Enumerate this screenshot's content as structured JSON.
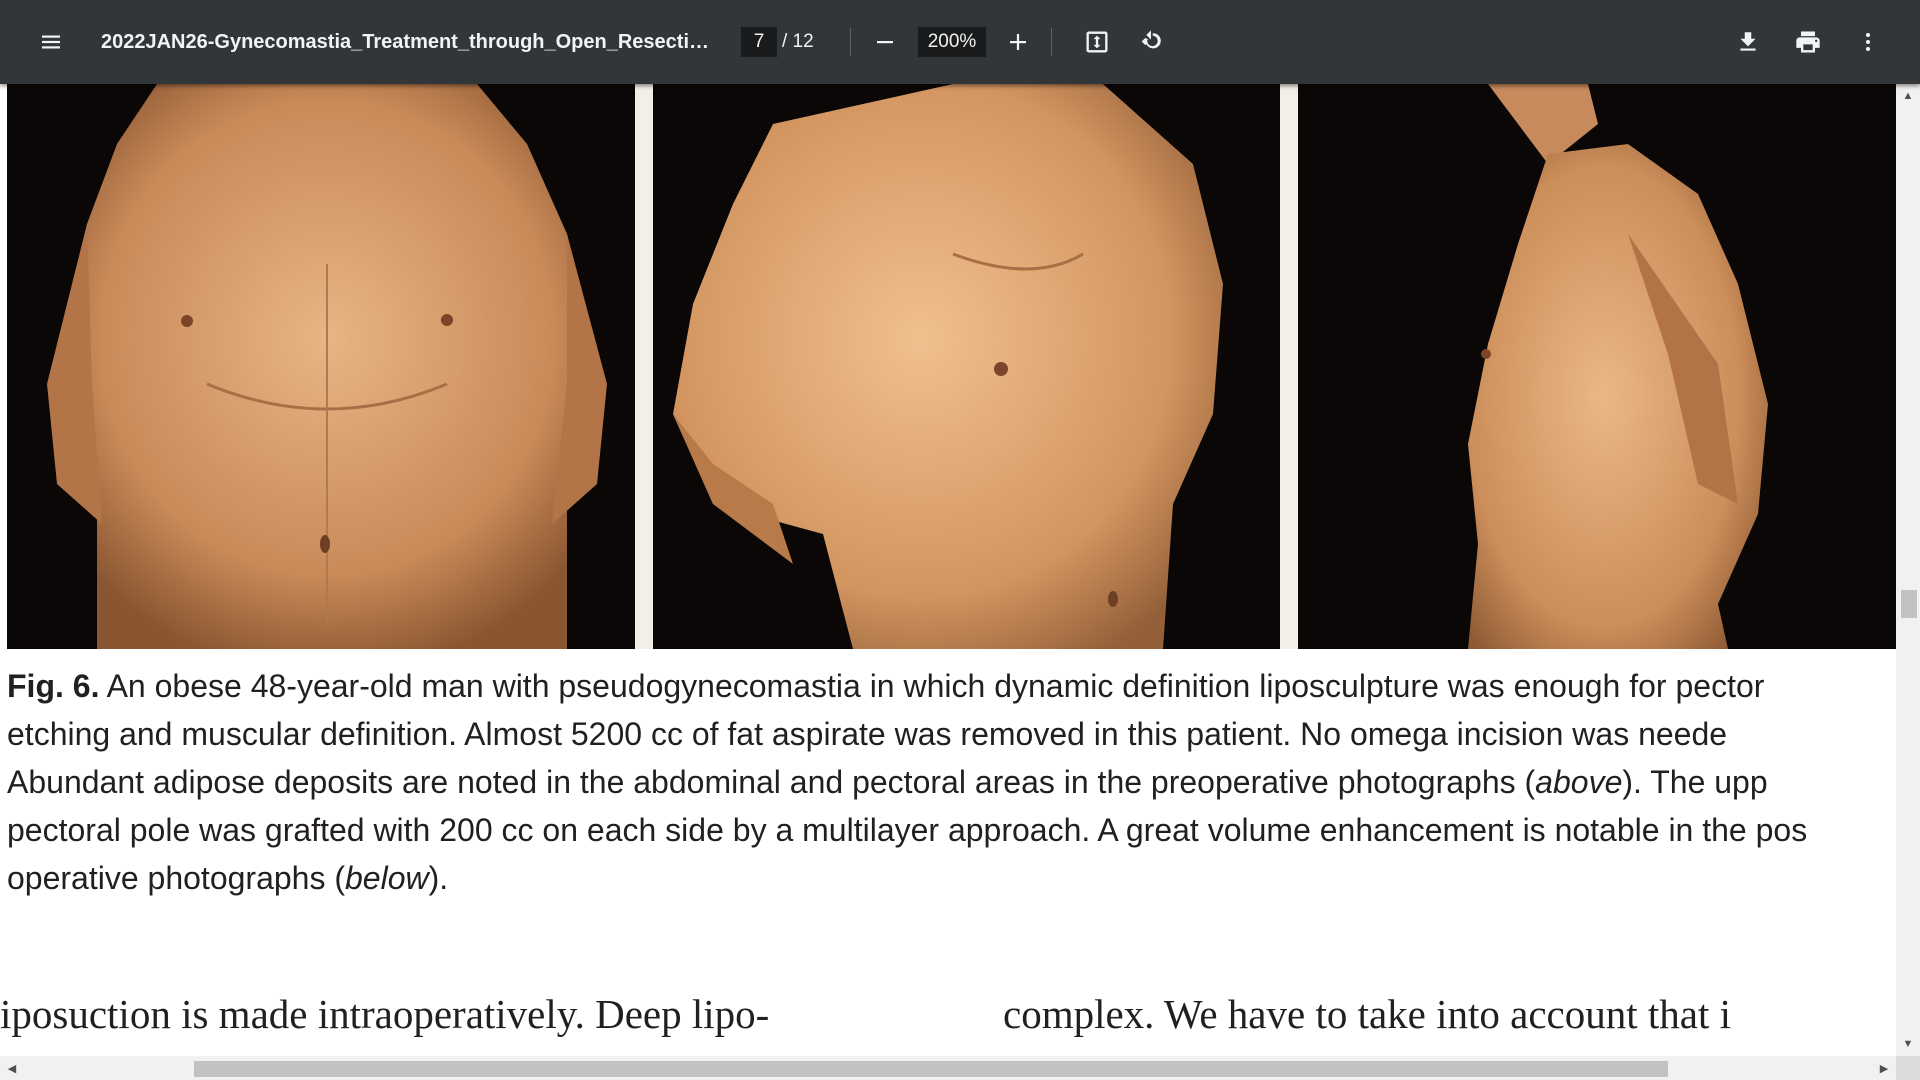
{
  "toolbar": {
    "menu_icon": "hamburger-menu-icon",
    "title": "2022JAN26-Gynecomastia_Treatment_through_Open_Resectio...",
    "current_page": "7",
    "total_pages": "/ 12",
    "zoom_out_icon": "minus-icon",
    "zoom_level": "200%",
    "zoom_in_icon": "plus-icon",
    "fit_icon": "fit-to-page-icon",
    "rotate_icon": "rotate-counterclockwise-icon",
    "download_icon": "download-icon",
    "print_icon": "print-icon",
    "more_icon": "more-vertical-icon"
  },
  "figure": {
    "caption_label": "Fig. 6.",
    "caption_line1": "An obese 48-year-old man with pseudogynecomastia in which dynamic definition liposculpture was enough for pector",
    "caption_line2": "etching and muscular definition. Almost 5200 cc of fat aspirate was removed in this patient. No omega incision was neede",
    "caption_line3_a": "Abundant adipose deposits are noted in the abdominal and pectoral areas in the preoperative photographs (",
    "caption_line3_italic": "above",
    "caption_line3_b": "). The upp",
    "caption_line4": "pectoral pole was grafted with 200 cc on each side by a multilayer approach. A great volume enhancement is notable in the pos",
    "caption_line5_a": "operative photographs (",
    "caption_line5_italic": "below",
    "caption_line5_b": ")."
  },
  "body": {
    "left_column_line1": "iposuction is made intraoperatively. Deep lipo-",
    "right_column_line1": "complex. We have to take into account that i"
  },
  "colors": {
    "toolbar_bg": "#323639",
    "photo_bg": "#0b0706",
    "skin": "#d49a6a",
    "page_bg": "#ffffff"
  }
}
